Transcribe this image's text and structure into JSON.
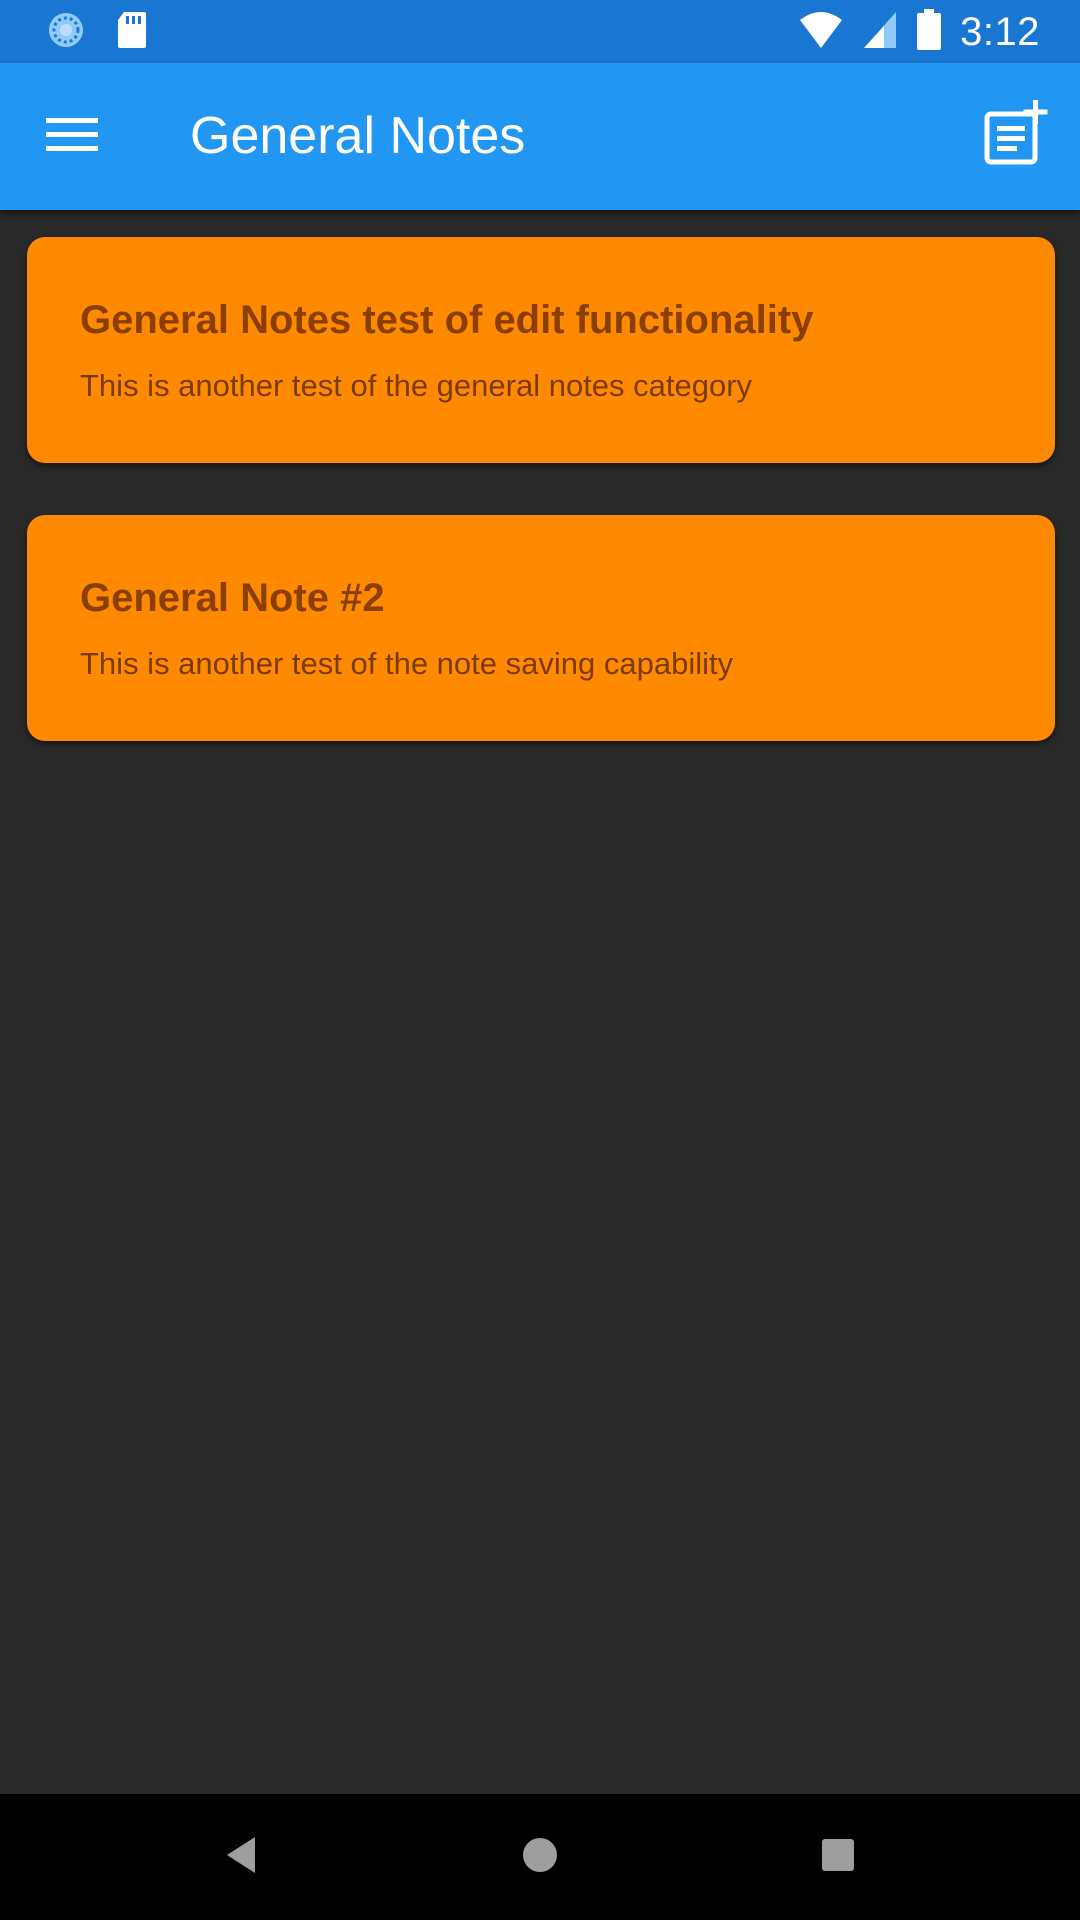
{
  "status_bar": {
    "time": "3:12",
    "icons": [
      "sync-icon",
      "sd-card-icon",
      "wifi-icon",
      "cell-signal-icon",
      "battery-icon"
    ],
    "background": "#1976D2"
  },
  "app_bar": {
    "title": "General Notes",
    "menu_icon": "hamburger-menu-icon",
    "action_icon": "add-note-icon",
    "background": "#2196F3"
  },
  "notes": [
    {
      "title": "General Notes test of edit functionality",
      "body": "This is another test of the general notes category"
    },
    {
      "title": "General Note #2",
      "body": "This is another test of the note saving capability"
    }
  ],
  "colors": {
    "card": "#FF8A00",
    "card_title": "#8A3F00",
    "card_body": "#7A3A00",
    "background": "#292929"
  },
  "nav_bar": {
    "icons": [
      "back-icon",
      "home-icon",
      "recents-icon"
    ]
  }
}
